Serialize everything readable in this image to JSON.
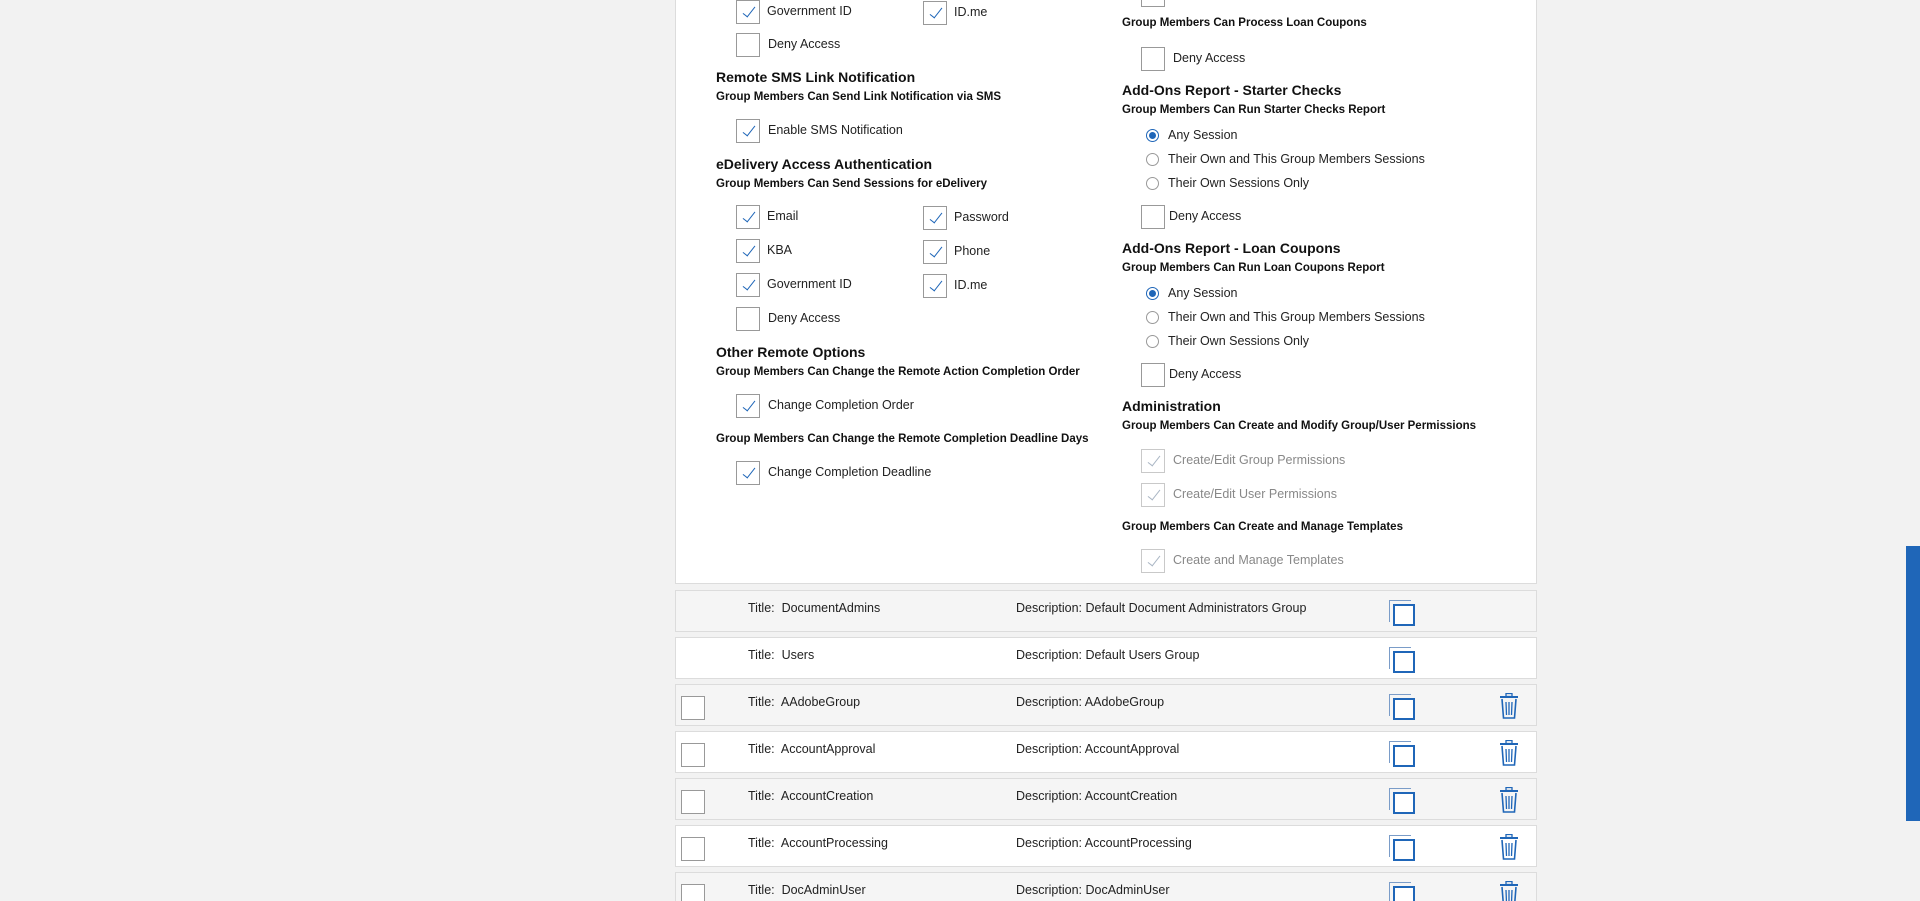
{
  "left": {
    "top_items": [
      {
        "label": "Government ID",
        "checked": true
      },
      {
        "label": "ID.me",
        "checked": true
      },
      {
        "label": "Deny Access",
        "checked": false
      }
    ],
    "sms": {
      "title": "Remote SMS Link Notification",
      "subtitle": "Group Members Can Send Link Notification via SMS",
      "items": [
        {
          "label": "Enable SMS Notification",
          "checked": true
        }
      ]
    },
    "edelivery": {
      "title": "eDelivery Access Authentication",
      "subtitle": "Group Members Can Send Sessions for eDelivery",
      "items": [
        {
          "label": "Email",
          "checked": true
        },
        {
          "label": "Password",
          "checked": true
        },
        {
          "label": "KBA",
          "checked": true
        },
        {
          "label": "Phone",
          "checked": true
        },
        {
          "label": "Government ID",
          "checked": true
        },
        {
          "label": "ID.me",
          "checked": true
        },
        {
          "label": "Deny Access",
          "checked": false
        }
      ]
    },
    "other": {
      "title": "Other Remote Options",
      "subtitle1": "Group Members Can Change the Remote Action Completion Order",
      "item1": "Change Completion Order",
      "subtitle2": "Group Members Can Change the Remote Completion Deadline Days",
      "item2": "Change Completion Deadline"
    }
  },
  "right": {
    "loan_coupons_sub": "Group Members Can Process Loan Coupons",
    "loan_coupons_deny": "Deny Access",
    "starter": {
      "title": "Add-Ons Report - Starter Checks",
      "subtitle": "Group Members Can Run Starter Checks Report",
      "options": [
        "Any Session",
        "Their Own and This Group Members Sessions",
        "Their Own Sessions Only"
      ],
      "selected": 0,
      "deny": "Deny Access"
    },
    "loan_report": {
      "title": "Add-Ons Report - Loan Coupons",
      "subtitle": "Group Members Can Run Loan Coupons Report",
      "options": [
        "Any Session",
        "Their Own and This Group Members Sessions",
        "Their Own Sessions Only"
      ],
      "selected": 0,
      "deny": "Deny Access"
    },
    "admin": {
      "title": "Administration",
      "subtitle": "Group Members Can Create and Modify Group/User Permissions",
      "items": [
        "Create/Edit Group Permissions",
        "Create/Edit User Permissions"
      ],
      "templates_sub": "Group Members Can Create and Manage Templates",
      "templates_item": "Create and Manage Templates"
    }
  },
  "groups": [
    {
      "title_label": "Title:",
      "title": "DocumentAdmins",
      "desc_label": "Description:",
      "desc": "Default Document Administrators Group"
    },
    {
      "title_label": "Title:",
      "title": "Users",
      "desc_label": "Description:",
      "desc": "Default Users Group"
    },
    {
      "title_label": "Title:",
      "title": "AAdobeGroup",
      "desc_label": "Description:",
      "desc": "AAdobeGroup"
    },
    {
      "title_label": "Title:",
      "title": "AccountApproval",
      "desc_label": "Description:",
      "desc": "AccountApproval"
    },
    {
      "title_label": "Title:",
      "title": "AccountCreation",
      "desc_label": "Description:",
      "desc": "AccountCreation"
    },
    {
      "title_label": "Title:",
      "title": "AccountProcessing",
      "desc_label": "Description:",
      "desc": "AccountProcessing"
    },
    {
      "title_label": "Title:",
      "title": "DocAdminUser",
      "desc_label": "Description:",
      "desc": "DocAdminUser"
    }
  ],
  "colors": {
    "accent": "#1f66b8"
  }
}
